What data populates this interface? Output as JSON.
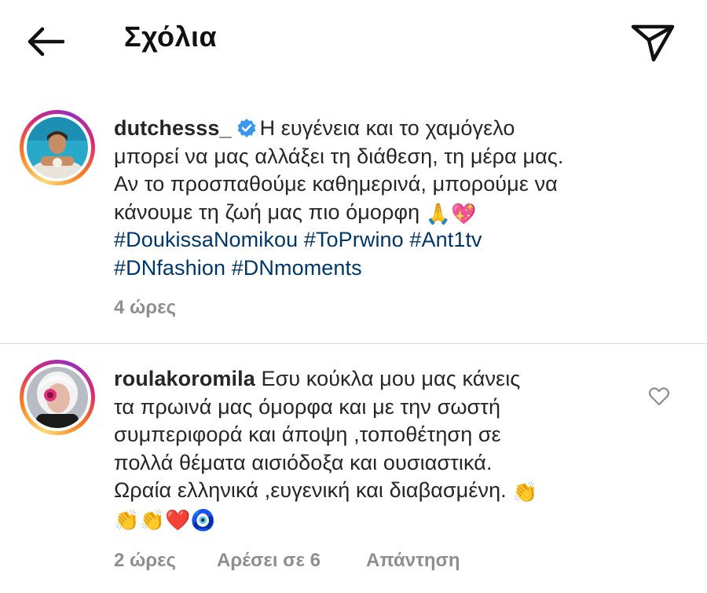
{
  "header": {
    "title": "Σχόλια",
    "back_icon": "arrow-left-icon",
    "share_icon": "paper-plane-icon"
  },
  "comments": [
    {
      "username": "dutchesss_",
      "verified": true,
      "lines": [
        "Η ευγένεια και το χαμόγελο",
        "μπορεί να μας αλλάξει τη διάθεση, τη μέρα μας.",
        "Αν το προσπαθούμε καθημερινά, μπορούμε να",
        "κάνουμε τη ζωή  μας πιο όμορφη"
      ],
      "line4_emojis": "🙏💖",
      "hashtags_line1": [
        "#DoukissaNomikou",
        "#ToPrwino",
        "#Ant1tv"
      ],
      "hashtags_line2": [
        "#DNfashion",
        "#DNmoments"
      ],
      "time": "4 ώρες"
    },
    {
      "username": "roulakoromila",
      "lines": [
        "Εσυ κούκλα μου μας κάνεις",
        "τα πρωινά μας όμορφα και με την σωστή",
        "συμπεριφορά και άποψη ,τοποθέτηση σε",
        "πολλά θέματα αισιόδοξα και  ουσιαστικά.",
        "Ωραία ελληνικά ,ευγενική και διαβασμένη."
      ],
      "line5_emoji": "👏",
      "final_emojis": "👏👏❤️🧿",
      "time": "2 ώρες",
      "likes": "Αρέσει σε 6",
      "reply": "Απάντηση"
    }
  ],
  "colors": {
    "hashtag": "#00376b",
    "meta": "#8e8e8e",
    "verified": "#3897f0",
    "divider": "#dbdbdb"
  }
}
